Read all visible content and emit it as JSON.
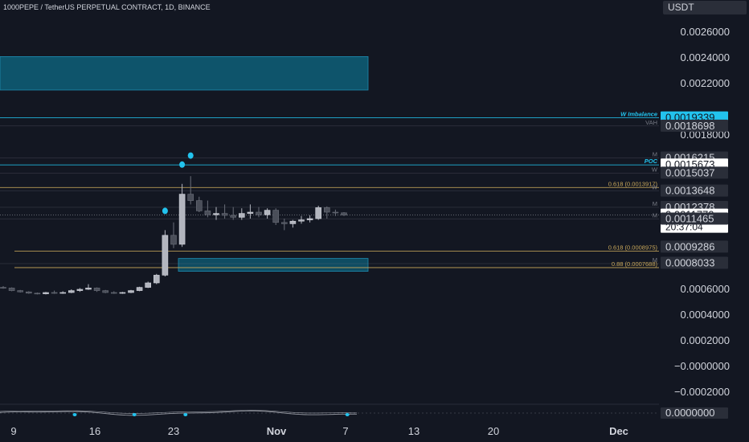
{
  "header": {
    "symbol_title": "1000PEPE / TetherUS PERPETUAL CONTRACT, 1D, BINANCE",
    "currency": "USDT"
  },
  "colors": {
    "background": "#131722",
    "zone": "#0e5f78",
    "zone_border": "#1f8bb0",
    "cyan": "#22c3ee",
    "fib": "#c8a75a",
    "up_candle": "#b2b5be",
    "down_candle": "#4a4e59"
  },
  "chart_data": {
    "type": "candlestick",
    "y_axis": {
      "ticks": [
        "0.0026000",
        "0.0024000",
        "0.0022000",
        "0.0018000",
        "0.0006000",
        "0.0004000",
        "0.0002000",
        "−0.0000000",
        "−0.0002000"
      ],
      "range": [
        -0.0002,
        0.0026
      ]
    },
    "x_axis": {
      "ticks": [
        "9",
        "16",
        "23",
        "Nov",
        "7",
        "13",
        "20",
        "Dec"
      ]
    },
    "price_labels": [
      {
        "value": "0.0019339",
        "style": "cyan"
      },
      {
        "value": "0.0018698",
        "style": "dark"
      },
      {
        "value": "0.0016215",
        "style": "dark"
      },
      {
        "value": "0.0015673",
        "style": "white"
      },
      {
        "value": "0.0015037",
        "style": "dark"
      },
      {
        "value": "0.0013648",
        "style": "dark"
      },
      {
        "value": "0.0012378",
        "style": "dark"
      },
      {
        "value": "0.0011770",
        "style": "current"
      },
      {
        "value": "0.0011465",
        "style": "dark"
      },
      {
        "value": "0.0009286",
        "style": "dark"
      },
      {
        "value": "0.0008033",
        "style": "dark"
      }
    ],
    "countdown": "20:37:04",
    "line_labels": [
      {
        "text": "W Imbalance",
        "price": 0.0019339,
        "color": "cyan"
      },
      {
        "text": "VAH",
        "price": 0.00187,
        "color": "gray"
      },
      {
        "text": "M",
        "price": 0.0016215,
        "color": "gray"
      },
      {
        "text": "POC",
        "price": 0.0015673,
        "color": "cyan"
      },
      {
        "text": "W",
        "price": 0.0015037,
        "color": "gray"
      },
      {
        "text": "0.618 (0.0013917)",
        "price": 0.0013917,
        "color": "fib"
      },
      {
        "text": "W",
        "price": 0.0013648,
        "color": "gray"
      },
      {
        "text": "M",
        "price": 0.0012378,
        "color": "gray"
      },
      {
        "text": "M",
        "price": 0.0011465,
        "color": "gray"
      },
      {
        "text": "0.618 (0.0008975)",
        "price": 0.0008975,
        "color": "fib"
      },
      {
        "text": "M",
        "price": 0.0008,
        "color": "gray"
      },
      {
        "text": "0.88 (0.0007688)",
        "price": 0.0007688,
        "color": "fib"
      }
    ],
    "zones": [
      {
        "top": 0.00241,
        "bottom": 0.00215
      },
      {
        "top": 0.00084,
        "bottom": 0.00074
      }
    ],
    "candles": [
      {
        "o": 0.000615,
        "h": 0.000625,
        "l": 0.000605,
        "c": 0.00061
      },
      {
        "o": 0.00061,
        "h": 0.000615,
        "l": 0.000585,
        "c": 0.00059
      },
      {
        "o": 0.00059,
        "h": 0.000595,
        "l": 0.000575,
        "c": 0.00058
      },
      {
        "o": 0.00058,
        "h": 0.000585,
        "l": 0.000565,
        "c": 0.00057
      },
      {
        "o": 0.00057,
        "h": 0.000575,
        "l": 0.00056,
        "c": 0.000565
      },
      {
        "o": 0.000565,
        "h": 0.00058,
        "l": 0.00056,
        "c": 0.000575
      },
      {
        "o": 0.000575,
        "h": 0.00059,
        "l": 0.000565,
        "c": 0.00057
      },
      {
        "o": 0.00057,
        "h": 0.000585,
        "l": 0.000565,
        "c": 0.000575
      },
      {
        "o": 0.000575,
        "h": 0.0006,
        "l": 0.00057,
        "c": 0.00059
      },
      {
        "o": 0.00059,
        "h": 0.00061,
        "l": 0.00058,
        "c": 0.0006
      },
      {
        "o": 0.0006,
        "h": 0.00064,
        "l": 0.000595,
        "c": 0.00061
      },
      {
        "o": 0.00061,
        "h": 0.000615,
        "l": 0.00058,
        "c": 0.00059
      },
      {
        "o": 0.00059,
        "h": 0.000595,
        "l": 0.00057,
        "c": 0.000575
      },
      {
        "o": 0.000575,
        "h": 0.000585,
        "l": 0.000565,
        "c": 0.00057
      },
      {
        "o": 0.00057,
        "h": 0.00058,
        "l": 0.000565,
        "c": 0.000575
      },
      {
        "o": 0.000575,
        "h": 0.000595,
        "l": 0.00057,
        "c": 0.00059
      },
      {
        "o": 0.00059,
        "h": 0.00062,
        "l": 0.000585,
        "c": 0.000615
      },
      {
        "o": 0.000615,
        "h": 0.00066,
        "l": 0.00061,
        "c": 0.00065
      },
      {
        "o": 0.00065,
        "h": 0.00072,
        "l": 0.00064,
        "c": 0.00071
      },
      {
        "o": 0.00071,
        "h": 0.00106,
        "l": 0.0007,
        "c": 0.00102
      },
      {
        "o": 0.00102,
        "h": 0.00112,
        "l": 0.00092,
        "c": 0.00095
      },
      {
        "o": 0.00095,
        "h": 0.00142,
        "l": 0.00093,
        "c": 0.00134
      },
      {
        "o": 0.00134,
        "h": 0.00148,
        "l": 0.00126,
        "c": 0.00129
      },
      {
        "o": 0.00129,
        "h": 0.00132,
        "l": 0.0012,
        "c": 0.00121
      },
      {
        "o": 0.00121,
        "h": 0.00129,
        "l": 0.00116,
        "c": 0.00118
      },
      {
        "o": 0.00118,
        "h": 0.00124,
        "l": 0.00114,
        "c": 0.00119
      },
      {
        "o": 0.00119,
        "h": 0.00126,
        "l": 0.00115,
        "c": 0.001175
      },
      {
        "o": 0.001175,
        "h": 0.00124,
        "l": 0.00114,
        "c": 0.00116
      },
      {
        "o": 0.00116,
        "h": 0.00123,
        "l": 0.00114,
        "c": 0.00119
      },
      {
        "o": 0.00119,
        "h": 0.00126,
        "l": 0.00115,
        "c": 0.0012
      },
      {
        "o": 0.0012,
        "h": 0.00124,
        "l": 0.00116,
        "c": 0.00118
      },
      {
        "o": 0.00118,
        "h": 0.00123,
        "l": 0.00115,
        "c": 0.001215
      },
      {
        "o": 0.001215,
        "h": 0.00123,
        "l": 0.0011,
        "c": 0.00112
      },
      {
        "o": 0.00112,
        "h": 0.00115,
        "l": 0.00106,
        "c": 0.00111
      },
      {
        "o": 0.00111,
        "h": 0.00114,
        "l": 0.00108,
        "c": 0.00113
      },
      {
        "o": 0.00113,
        "h": 0.00117,
        "l": 0.00111,
        "c": 0.00114
      },
      {
        "o": 0.00114,
        "h": 0.001175,
        "l": 0.00112,
        "c": 0.00115
      },
      {
        "o": 0.00115,
        "h": 0.00125,
        "l": 0.00114,
        "c": 0.001235
      },
      {
        "o": 0.001235,
        "h": 0.001245,
        "l": 0.00115,
        "c": 0.0012
      },
      {
        "o": 0.0012,
        "h": 0.00122,
        "l": 0.00117,
        "c": 0.001195
      },
      {
        "o": 0.001195,
        "h": 0.0012,
        "l": 0.00117,
        "c": 0.001177
      }
    ],
    "markers": [
      {
        "index": 19,
        "price": 0.00116
      },
      {
        "index": 21,
        "price": 0.00152
      },
      {
        "index": 22,
        "price": 0.00159
      }
    ],
    "oscillator": {
      "markers": [
        5,
        12,
        18,
        37
      ]
    }
  }
}
